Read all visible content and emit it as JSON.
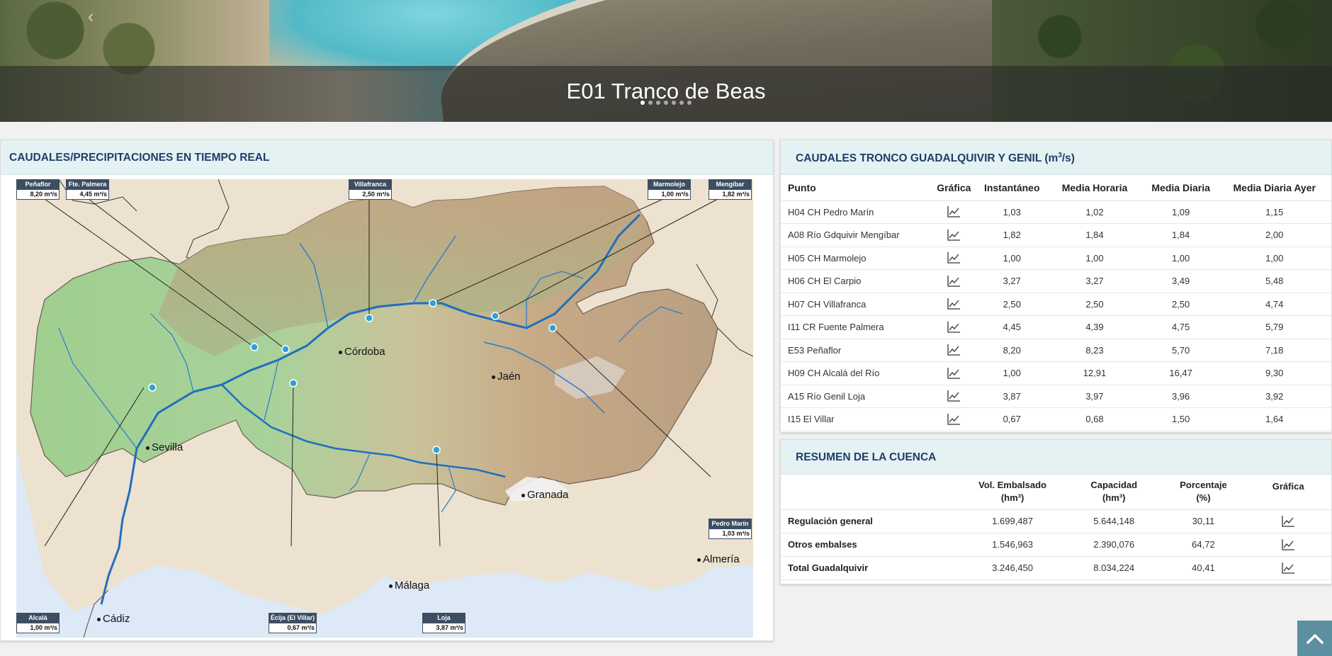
{
  "hero": {
    "title": "E01 Tranco de Beas",
    "slides": 7,
    "active_slide": 0,
    "prev_arrow": "‹"
  },
  "realtime": {
    "title": "CAUDALES/PRECIPITACIONES EN TIEMPO REAL",
    "stations": {
      "penaflor": {
        "name": "Peñaflor",
        "value": "8,20 m³/s"
      },
      "palmera": {
        "name": "Fte. Palmera",
        "value": "4,45 m³/s"
      },
      "villafranca": {
        "name": "Villafranca",
        "value": "2,50 m³/s"
      },
      "marmolejo": {
        "name": "Marmolejo",
        "value": "1,00 m³/s"
      },
      "mengibar": {
        "name": "Mengíbar",
        "value": "1,82 m³/s"
      },
      "pedromarin": {
        "name": "Pedro Marín",
        "value": "1,03 m³/s"
      },
      "alcala": {
        "name": "Alcalá",
        "value": "1,00 m³/s"
      },
      "ecija": {
        "name": "Écija (El Villar)",
        "value": "0,67 m³/s"
      },
      "loja": {
        "name": "Loja",
        "value": "3,87 m³/s"
      }
    },
    "cities": {
      "cordoba": "Córdoba",
      "jaen": "Jaén",
      "sevilla": "Sevilla",
      "granada": "Granada",
      "malaga": "Málaga",
      "almeria": "Almería",
      "cadiz": "Cádiz"
    }
  },
  "caudales": {
    "title": "CAUDALES TRONCO GUADALQUIVIR Y GENIL (m",
    "title_sup": "3",
    "title_suffix": "/s)",
    "columns": [
      "Punto",
      "Gráfica",
      "Instantáneo",
      "Media Horaria",
      "Media Diaria",
      "Media Diaria Ayer"
    ],
    "rows": [
      {
        "punto": "H04 CH Pedro Marín",
        "inst": "1,03",
        "horaria": "1,02",
        "diaria": "1,09",
        "ayer": "1,15"
      },
      {
        "punto": "A08 Río Gdquivir Mengíbar",
        "inst": "1,82",
        "horaria": "1,84",
        "diaria": "1,84",
        "ayer": "2,00"
      },
      {
        "punto": "H05 CH Marmolejo",
        "inst": "1,00",
        "horaria": "1,00",
        "diaria": "1,00",
        "ayer": "1,00"
      },
      {
        "punto": "H06 CH El Carpio",
        "inst": "3,27",
        "horaria": "3,27",
        "diaria": "3,49",
        "ayer": "5,48"
      },
      {
        "punto": "H07 CH Villafranca",
        "inst": "2,50",
        "horaria": "2,50",
        "diaria": "2,50",
        "ayer": "4,74"
      },
      {
        "punto": "I11 CR Fuente Palmera",
        "inst": "4,45",
        "horaria": "4,39",
        "diaria": "4,75",
        "ayer": "5,79"
      },
      {
        "punto": "E53 Peñaflor",
        "inst": "8,20",
        "horaria": "8,23",
        "diaria": "5,70",
        "ayer": "7,18"
      },
      {
        "punto": "H09 CH Alcalá del Río",
        "inst": "1,00",
        "horaria": "12,91",
        "diaria": "16,47",
        "ayer": "9,30"
      },
      {
        "punto": "A15 Río Genil Loja",
        "inst": "3,87",
        "horaria": "3,97",
        "diaria": "3,96",
        "ayer": "3,92"
      },
      {
        "punto": "I15 El Villar",
        "inst": "0,67",
        "horaria": "0,68",
        "diaria": "1,50",
        "ayer": "1,64"
      }
    ]
  },
  "resumen": {
    "title": "RESUMEN DE LA CUENCA",
    "columns": {
      "vol": "Vol. Embalsado",
      "vol_unit": "(hm³)",
      "cap": "Capacidad",
      "cap_unit": "(hm³)",
      "pct": "Porcentaje",
      "pct_unit": "(%)",
      "graf": "Gráfica"
    },
    "rows": [
      {
        "name": "Regulación general",
        "vol": "1.699,487",
        "cap": "5.644,148",
        "pct": "30,11"
      },
      {
        "name": "Otros embalses",
        "vol": "1.546,963",
        "cap": "2.390,076",
        "pct": "64,72"
      },
      {
        "name": "Total Guadalquivir",
        "vol": "3.246,450",
        "cap": "8.034,224",
        "pct": "40,41"
      }
    ]
  },
  "colors": {
    "header_bg": "#e5f2f3",
    "header_text": "#1f3e6b",
    "label_bg": "#3d4e62",
    "river": "#1f6fbf",
    "back_top": "#5c8fa0"
  },
  "icons": {
    "chart": "line-chart-icon",
    "back_to_top": "chevron-up-icon",
    "station": "station-marker-icon"
  }
}
